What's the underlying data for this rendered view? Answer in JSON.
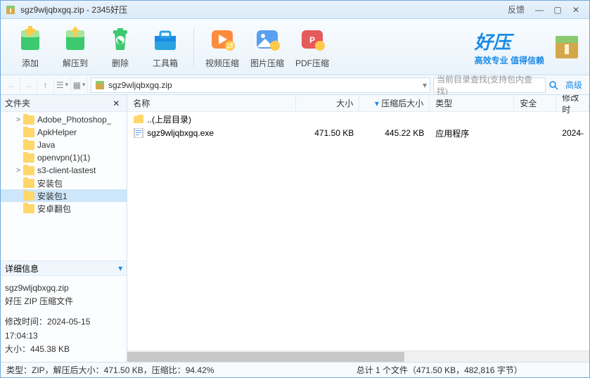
{
  "title": {
    "file": "sgz9wljqbxgq.zip",
    "app": "2345好压"
  },
  "titlebar": {
    "feedback": "反馈"
  },
  "tools": [
    {
      "label": "添加",
      "color": "#3cc96f"
    },
    {
      "label": "解压到",
      "color": "#3cc96f"
    },
    {
      "label": "删除",
      "color": "#3cc96f"
    },
    {
      "label": "工具箱",
      "color": "#2aa3e0"
    }
  ],
  "tools2": [
    {
      "label": "视频压缩",
      "color": "#ff8b3d"
    },
    {
      "label": "图片压缩",
      "color": "#5aa0f0"
    },
    {
      "label": "PDF压缩",
      "color": "#e55a5a"
    }
  ],
  "brand": {
    "t1": "好压",
    "t2": "高效专业 值得信赖"
  },
  "path": "sgz9wljqbxgq.zip",
  "search": {
    "placeholder": "当前目录查找(支持包内查找)",
    "adv": "高级"
  },
  "side": {
    "title": "文件夹"
  },
  "tree": [
    {
      "name": "Adobe_Photoshop_",
      "expand": ">",
      "indent": 1
    },
    {
      "name": "ApkHelper",
      "expand": "",
      "indent": 1
    },
    {
      "name": "Java",
      "expand": "",
      "indent": 1
    },
    {
      "name": "openvpn(1)(1)",
      "expand": "",
      "indent": 1
    },
    {
      "name": "s3-client-lastest",
      "expand": ">",
      "indent": 1
    },
    {
      "name": "安装包",
      "expand": "",
      "indent": 1
    },
    {
      "name": "安装包1",
      "expand": "",
      "indent": 1,
      "sel": true
    },
    {
      "name": "安卓翻包",
      "expand": "",
      "indent": 1
    }
  ],
  "detail": {
    "title": "详细信息",
    "name": "sgz9wljqbxgq.zip",
    "type": "好压 ZIP 压缩文件",
    "mtime_label": "修改时间：",
    "mtime": "2024-05-15 17:04:13",
    "size_label": "大小：",
    "size": "445.38 KB"
  },
  "cols": {
    "name": "名称",
    "size": "大小",
    "csize": "压缩后大小",
    "type": "类型",
    "safe": "安全",
    "mtime": "修改时"
  },
  "rows": [
    {
      "name": "..(上层目录)",
      "size": "",
      "csize": "",
      "type": "",
      "mtime": "",
      "icon": "folder"
    },
    {
      "name": "sgz9wljqbxgq.exe",
      "size": "471.50 KB",
      "csize": "445.22 KB",
      "type": "应用程序",
      "mtime": "2024-",
      "icon": "exe"
    }
  ],
  "status": {
    "left": "类型：ZIP，解压后大小：471.50 KB，压缩比：94.42%",
    "right": "总计 1 个文件（471.50 KB，482,816 字节）"
  }
}
